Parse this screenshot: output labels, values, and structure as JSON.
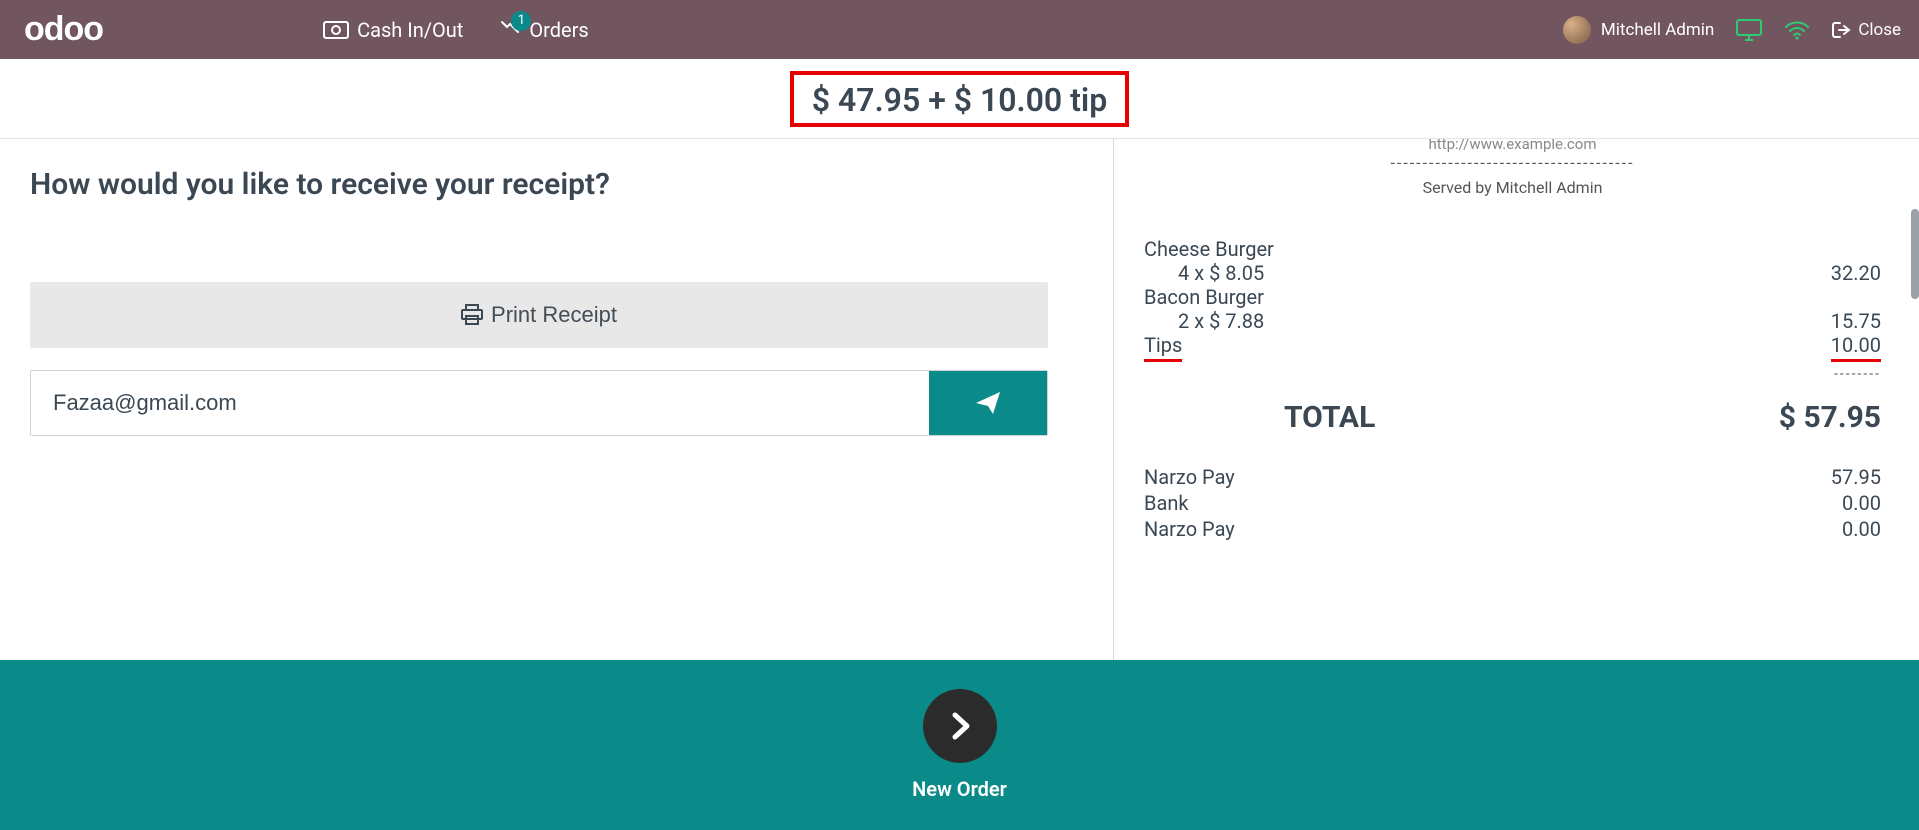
{
  "topbar": {
    "logo": "odoo",
    "cash_label": "Cash In/Out",
    "orders_label": "Orders",
    "orders_badge": "1",
    "username": "Mitchell Admin",
    "close_label": "Close"
  },
  "totals": {
    "banner_text": "$ 47.95 + $ 10.00 tip"
  },
  "receipt_prompt": {
    "question": "How would you like to receive your receipt?",
    "print_label": "Print Receipt",
    "email_value": "Fazaa@gmail.com"
  },
  "receipt_preview": {
    "website": "http://www.example.com",
    "dash_line": "--------------------------------------",
    "served_by": "Served by Mitchell Admin",
    "items": [
      {
        "name": "Cheese Burger",
        "sub": "4 x $ 8.05",
        "amount": "32.20"
      },
      {
        "name": "Bacon Burger",
        "sub": "2 x $ 7.88",
        "amount": "15.75"
      }
    ],
    "tips_label": "Tips",
    "tips_amount": "10.00",
    "dash_right": "--------",
    "total_label": "TOTAL",
    "total_amount": "$ 57.95",
    "payments": [
      {
        "name": "Narzo Pay",
        "amount": "57.95"
      },
      {
        "name": "Bank",
        "amount": "0.00"
      },
      {
        "name": "Narzo Pay",
        "amount": "0.00"
      }
    ]
  },
  "bottom": {
    "new_order_label": "New Order"
  }
}
